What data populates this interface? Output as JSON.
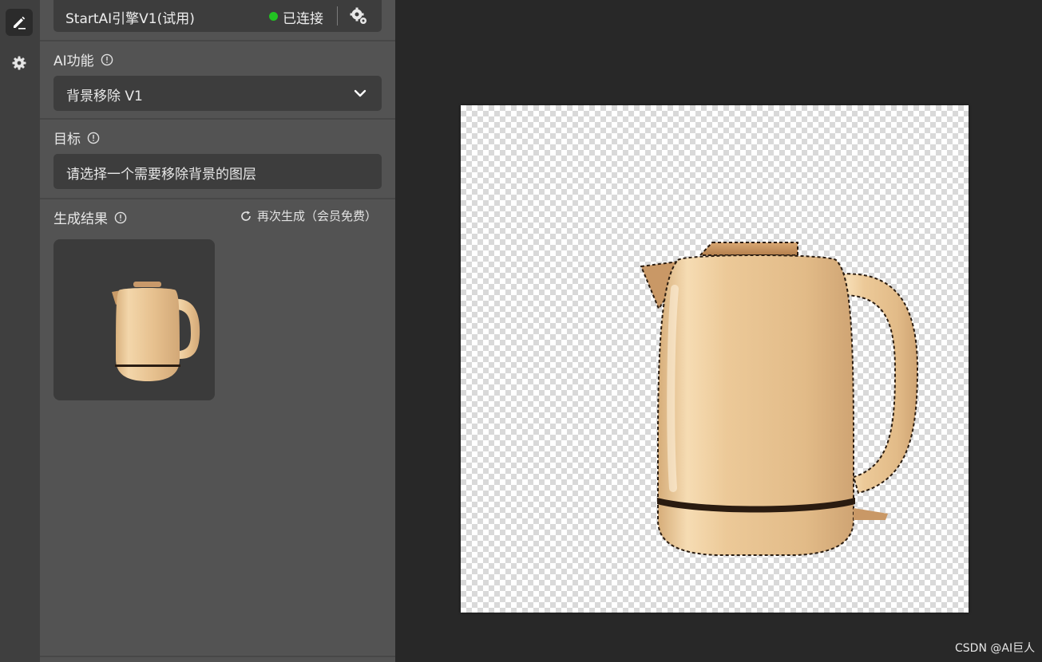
{
  "engine": {
    "name": "StartAI引擎V1(试用)",
    "status": "已连接",
    "status_color": "#22c322"
  },
  "ai_function": {
    "label": "AI功能",
    "selected": "背景移除 V1"
  },
  "target": {
    "label": "目标",
    "placeholder": "请选择一个需要移除背景的图层"
  },
  "results": {
    "label": "生成结果",
    "regenerate": "再次生成（会员免费）"
  },
  "icons": {
    "rail": [
      "pen-icon",
      "gear-icon"
    ],
    "engine": "settings-cluster-icon"
  },
  "colors": {
    "panel": "#535353",
    "rail": "#3f3f3f",
    "canvas_bg": "#282828",
    "kettle": "#e8c596"
  },
  "watermark": "CSDN @AI巨人"
}
